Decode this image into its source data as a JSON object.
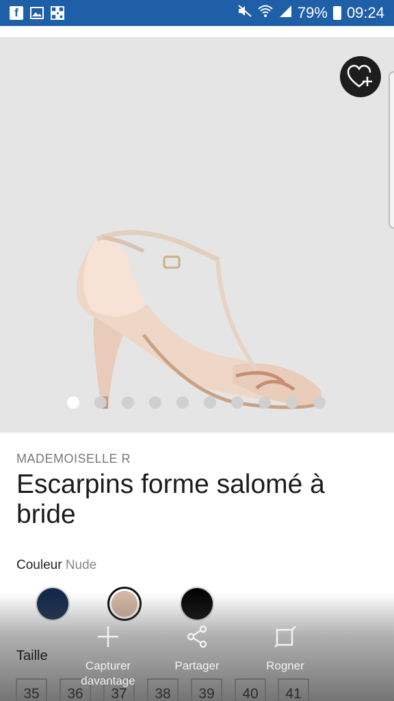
{
  "status_bar": {
    "battery": "79%",
    "time": "09:24"
  },
  "product": {
    "brand": "MADEMOISELLE R",
    "title": "Escarpins forme salomé à bride",
    "color_label": "Couleur",
    "color_value": "Nude",
    "swatches": [
      {
        "name": "navy",
        "color": "#13294b",
        "selected": false
      },
      {
        "name": "nude",
        "color": "#d5b7a3",
        "selected": true
      },
      {
        "name": "black",
        "color": "#050505",
        "selected": false
      }
    ],
    "size_label": "Taille",
    "sizes": [
      "35",
      "36",
      "37",
      "38",
      "39",
      "40",
      "41"
    ]
  },
  "gallery": {
    "dot_count": 10,
    "active_index": 0
  },
  "screenshot_toolbar": {
    "capture_label": "Capturer davantage",
    "share_label": "Partager",
    "crop_label": "Rogner"
  }
}
